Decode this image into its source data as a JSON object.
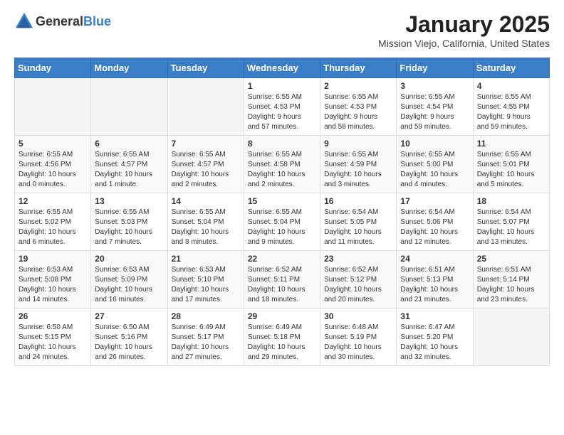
{
  "logo": {
    "general": "General",
    "blue": "Blue"
  },
  "header": {
    "month": "January 2025",
    "location": "Mission Viejo, California, United States"
  },
  "weekdays": [
    "Sunday",
    "Monday",
    "Tuesday",
    "Wednesday",
    "Thursday",
    "Friday",
    "Saturday"
  ],
  "weeks": [
    [
      {
        "day": "",
        "info": ""
      },
      {
        "day": "",
        "info": ""
      },
      {
        "day": "",
        "info": ""
      },
      {
        "day": "1",
        "info": "Sunrise: 6:55 AM\nSunset: 4:53 PM\nDaylight: 9 hours\nand 57 minutes."
      },
      {
        "day": "2",
        "info": "Sunrise: 6:55 AM\nSunset: 4:53 PM\nDaylight: 9 hours\nand 58 minutes."
      },
      {
        "day": "3",
        "info": "Sunrise: 6:55 AM\nSunset: 4:54 PM\nDaylight: 9 hours\nand 59 minutes."
      },
      {
        "day": "4",
        "info": "Sunrise: 6:55 AM\nSunset: 4:55 PM\nDaylight: 9 hours\nand 59 minutes."
      }
    ],
    [
      {
        "day": "5",
        "info": "Sunrise: 6:55 AM\nSunset: 4:56 PM\nDaylight: 10 hours\nand 0 minutes."
      },
      {
        "day": "6",
        "info": "Sunrise: 6:55 AM\nSunset: 4:57 PM\nDaylight: 10 hours\nand 1 minute."
      },
      {
        "day": "7",
        "info": "Sunrise: 6:55 AM\nSunset: 4:57 PM\nDaylight: 10 hours\nand 2 minutes."
      },
      {
        "day": "8",
        "info": "Sunrise: 6:55 AM\nSunset: 4:58 PM\nDaylight: 10 hours\nand 2 minutes."
      },
      {
        "day": "9",
        "info": "Sunrise: 6:55 AM\nSunset: 4:59 PM\nDaylight: 10 hours\nand 3 minutes."
      },
      {
        "day": "10",
        "info": "Sunrise: 6:55 AM\nSunset: 5:00 PM\nDaylight: 10 hours\nand 4 minutes."
      },
      {
        "day": "11",
        "info": "Sunrise: 6:55 AM\nSunset: 5:01 PM\nDaylight: 10 hours\nand 5 minutes."
      }
    ],
    [
      {
        "day": "12",
        "info": "Sunrise: 6:55 AM\nSunset: 5:02 PM\nDaylight: 10 hours\nand 6 minutes."
      },
      {
        "day": "13",
        "info": "Sunrise: 6:55 AM\nSunset: 5:03 PM\nDaylight: 10 hours\nand 7 minutes."
      },
      {
        "day": "14",
        "info": "Sunrise: 6:55 AM\nSunset: 5:04 PM\nDaylight: 10 hours\nand 8 minutes."
      },
      {
        "day": "15",
        "info": "Sunrise: 6:55 AM\nSunset: 5:04 PM\nDaylight: 10 hours\nand 9 minutes."
      },
      {
        "day": "16",
        "info": "Sunrise: 6:54 AM\nSunset: 5:05 PM\nDaylight: 10 hours\nand 11 minutes."
      },
      {
        "day": "17",
        "info": "Sunrise: 6:54 AM\nSunset: 5:06 PM\nDaylight: 10 hours\nand 12 minutes."
      },
      {
        "day": "18",
        "info": "Sunrise: 6:54 AM\nSunset: 5:07 PM\nDaylight: 10 hours\nand 13 minutes."
      }
    ],
    [
      {
        "day": "19",
        "info": "Sunrise: 6:53 AM\nSunset: 5:08 PM\nDaylight: 10 hours\nand 14 minutes."
      },
      {
        "day": "20",
        "info": "Sunrise: 6:53 AM\nSunset: 5:09 PM\nDaylight: 10 hours\nand 16 minutes."
      },
      {
        "day": "21",
        "info": "Sunrise: 6:53 AM\nSunset: 5:10 PM\nDaylight: 10 hours\nand 17 minutes."
      },
      {
        "day": "22",
        "info": "Sunrise: 6:52 AM\nSunset: 5:11 PM\nDaylight: 10 hours\nand 18 minutes."
      },
      {
        "day": "23",
        "info": "Sunrise: 6:52 AM\nSunset: 5:12 PM\nDaylight: 10 hours\nand 20 minutes."
      },
      {
        "day": "24",
        "info": "Sunrise: 6:51 AM\nSunset: 5:13 PM\nDaylight: 10 hours\nand 21 minutes."
      },
      {
        "day": "25",
        "info": "Sunrise: 6:51 AM\nSunset: 5:14 PM\nDaylight: 10 hours\nand 23 minutes."
      }
    ],
    [
      {
        "day": "26",
        "info": "Sunrise: 6:50 AM\nSunset: 5:15 PM\nDaylight: 10 hours\nand 24 minutes."
      },
      {
        "day": "27",
        "info": "Sunrise: 6:50 AM\nSunset: 5:16 PM\nDaylight: 10 hours\nand 26 minutes."
      },
      {
        "day": "28",
        "info": "Sunrise: 6:49 AM\nSunset: 5:17 PM\nDaylight: 10 hours\nand 27 minutes."
      },
      {
        "day": "29",
        "info": "Sunrise: 6:49 AM\nSunset: 5:18 PM\nDaylight: 10 hours\nand 29 minutes."
      },
      {
        "day": "30",
        "info": "Sunrise: 6:48 AM\nSunset: 5:19 PM\nDaylight: 10 hours\nand 30 minutes."
      },
      {
        "day": "31",
        "info": "Sunrise: 6:47 AM\nSunset: 5:20 PM\nDaylight: 10 hours\nand 32 minutes."
      },
      {
        "day": "",
        "info": ""
      }
    ]
  ]
}
